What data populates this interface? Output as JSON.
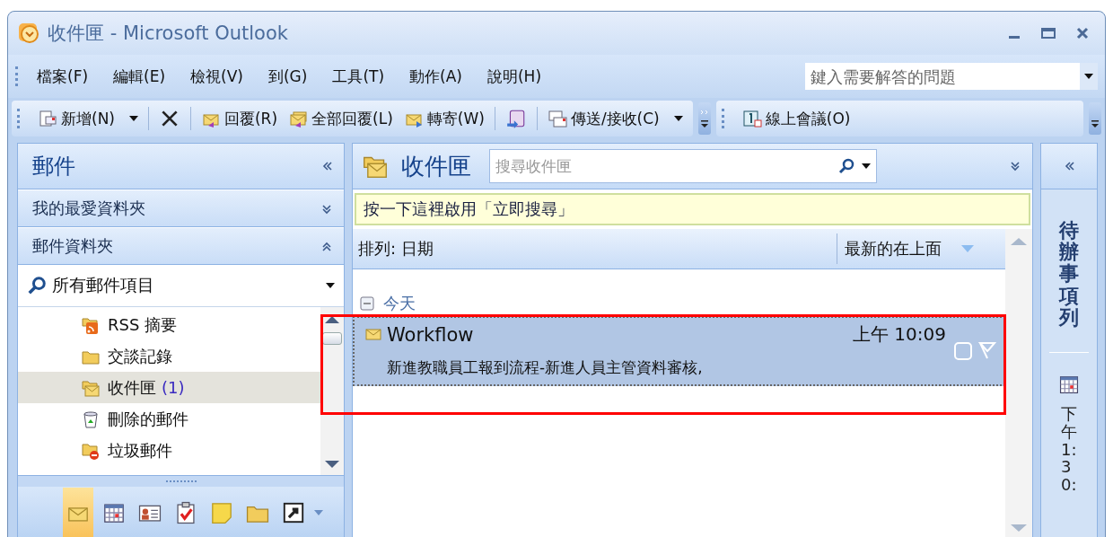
{
  "window": {
    "title": "收件匣 - Microsoft Outlook"
  },
  "menu": [
    {
      "label": "檔案(F)"
    },
    {
      "label": "編輯(E)"
    },
    {
      "label": "檢視(V)"
    },
    {
      "label": "到(G)"
    },
    {
      "label": "工具(T)"
    },
    {
      "label": "動作(A)"
    },
    {
      "label": "說明(H)"
    }
  ],
  "help_box": {
    "placeholder": "鍵入需要解答的問題"
  },
  "toolbar": [
    {
      "kind": "split",
      "label": "新增(N)"
    },
    {
      "kind": "icon"
    },
    {
      "kind": "button",
      "label": "回覆(R)"
    },
    {
      "kind": "button",
      "label": "全部回覆(L)"
    },
    {
      "kind": "button",
      "label": "轉寄(W)"
    },
    {
      "kind": "icon"
    },
    {
      "kind": "split",
      "label": "傳送/接收(C)"
    }
  ],
  "toolbar2": [
    {
      "kind": "button",
      "label": "線上會議(O)"
    }
  ],
  "nav": {
    "title": "郵件",
    "sections": [
      {
        "label": "我的最愛資料夾",
        "expanded": false
      },
      {
        "label": "郵件資料夾",
        "expanded": true
      }
    ],
    "view": "所有郵件項目",
    "folders": [
      {
        "label": "RSS 摘要",
        "selected": false
      },
      {
        "label": "交談記錄",
        "selected": false
      },
      {
        "label": "收件匣",
        "count": "(1)",
        "selected": true
      },
      {
        "label": "刪除的郵件",
        "selected": false
      },
      {
        "label": "垃圾郵件",
        "selected": false
      }
    ],
    "buttons": [
      {
        "selected": true
      },
      {
        "selected": false
      },
      {
        "selected": false
      },
      {
        "selected": false
      },
      {
        "selected": false
      },
      {
        "selected": false
      },
      {
        "selected": false
      }
    ]
  },
  "inbox": {
    "title": "收件匣",
    "search": {
      "placeholder": "搜尋收件匣"
    },
    "instant_search": "按一下這裡啟用「立即搜尋」",
    "sort": {
      "label": "排列: 日期",
      "order": "最新的在上面"
    },
    "groups": [
      {
        "label": "今天",
        "expanded": true,
        "messages": [
          {
            "sender": "Workflow",
            "time": "上午 10:09",
            "preview": "新進教職員工報到流程-新進人員主管資料審核,",
            "selected": true
          }
        ]
      }
    ]
  },
  "todo_bar": {
    "title": "待辦事項列",
    "appointment": "下午 1:30:"
  }
}
